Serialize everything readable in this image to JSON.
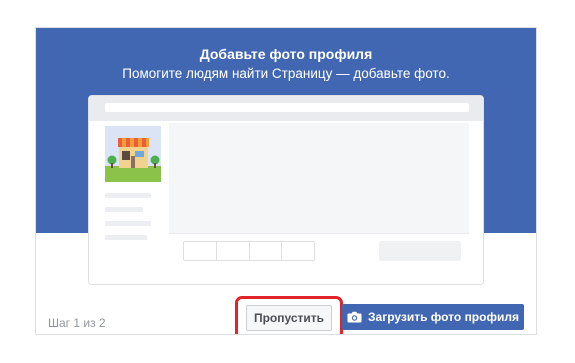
{
  "dialog": {
    "title": "Добавьте фото профиля",
    "subtitle": "Помогите людям найти Страницу — добавьте фото."
  },
  "preview": {
    "illustration_icon": "storefront-icon"
  },
  "footer": {
    "step_text": "Шаг 1 из 2",
    "skip_label": "Пропустить",
    "upload_label": "Загрузить фото профиля",
    "upload_icon": "camera-icon"
  },
  "colors": {
    "brand_blue": "#4267b2",
    "highlight_red": "#e0242a",
    "border_gray": "#dddfe2",
    "page_bg": "#ffffff"
  }
}
